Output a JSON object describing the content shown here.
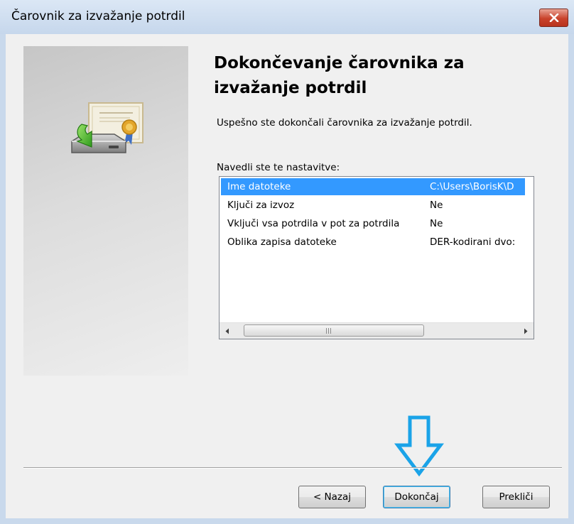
{
  "window": {
    "title": "Čarovnik za izvažanje potrdil"
  },
  "icons": {
    "close": "close-x-icon",
    "wizard": "certificate-export-icon",
    "scroll_left": "triangle-left-icon",
    "scroll_right": "triangle-right-icon",
    "annotation": "down-arrow-annotation-icon"
  },
  "main": {
    "heading_line1": "Dokončevanje čarovnika za",
    "heading_line2": "izvažanje potrdil",
    "description": "Uspešno ste dokončali čarovnika za izvažanje potrdil.",
    "list_label": "Navedli ste te nastavitve:",
    "settings": [
      {
        "name": "Ime datoteke",
        "value": "C:\\Users\\BorisK\\D"
      },
      {
        "name": "Ključi za izvoz",
        "value": "Ne"
      },
      {
        "name": "Vključi vsa potrdila v pot za potrdila",
        "value": "Ne"
      },
      {
        "name": "Oblika zapisa datoteke",
        "value": "DER-kodirani dvo:"
      }
    ],
    "selected_row": 0
  },
  "buttons": {
    "back": "< Nazaj",
    "finish": "Dokončaj",
    "cancel": "Prekliči"
  },
  "colors": {
    "selection": "#3399ff",
    "annotation_arrow": "#1aa3e8",
    "close_button": "#c9422b"
  }
}
